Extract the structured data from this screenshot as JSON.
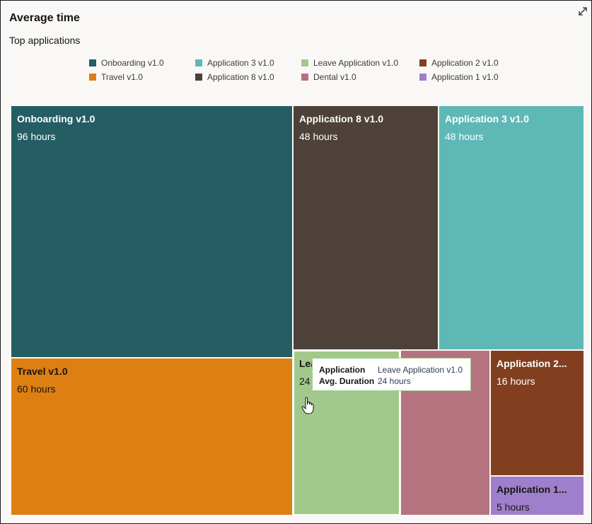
{
  "header": {
    "title": "Average time",
    "subtitle": "Top applications",
    "expand_icon": "expand-arrows-icon"
  },
  "legend": [
    {
      "label": "Onboarding v1.0",
      "color": "#245d63"
    },
    {
      "label": "Application 3 v1.0",
      "color": "#5eb9b6"
    },
    {
      "label": "Leave Application v1.0",
      "color": "#a2c98c"
    },
    {
      "label": "Application 2 v1.0",
      "color": "#823f1f"
    },
    {
      "label": "Travel v1.0",
      "color": "#de7f12"
    },
    {
      "label": "Application 8 v1.0",
      "color": "#4e4139"
    },
    {
      "label": "Dental v1.0",
      "color": "#b57380"
    },
    {
      "label": "Application 1 v1.0",
      "color": "#9f7fcc"
    }
  ],
  "chart_data": {
    "type": "treemap",
    "title": "Average time",
    "subtitle": "Top applications",
    "unit": "hours",
    "legend_position": "top",
    "items": [
      {
        "name": "Onboarding v1.0",
        "display_label": "Onboarding v1.0",
        "value": 96,
        "value_label": "96 hours",
        "color": "#245d63"
      },
      {
        "name": "Travel v1.0",
        "display_label": "Travel v1.0",
        "value": 60,
        "value_label": "60 hours",
        "color": "#de7f12"
      },
      {
        "name": "Application 8 v1.0",
        "display_label": "Application 8 v1.0",
        "value": 48,
        "value_label": "48 hours",
        "color": "#4e4139"
      },
      {
        "name": "Application 3 v1.0",
        "display_label": "Application 3 v1.0",
        "value": 48,
        "value_label": "48 hours",
        "color": "#5eb9b6"
      },
      {
        "name": "Leave Application v1.0",
        "display_label": "Lea",
        "value": 24,
        "value_label": "24",
        "color": "#a2c98c"
      },
      {
        "name": "Dental v1.0",
        "display_label": "",
        "value": 20,
        "value_label": "",
        "color": "#b57380"
      },
      {
        "name": "Application 2 v1.0",
        "display_label": "Application 2...",
        "value": 16,
        "value_label": "16 hours",
        "color": "#823f1f"
      },
      {
        "name": "Application 1 v1.0",
        "display_label": "Application 1...",
        "value": 5,
        "value_label": "5 hours",
        "color": "#9f7fcc"
      }
    ]
  },
  "tooltip": {
    "rows": [
      {
        "key": "Application",
        "value": "Leave Application v1.0"
      },
      {
        "key": "Avg. Duration",
        "value": "24 hours"
      }
    ]
  }
}
